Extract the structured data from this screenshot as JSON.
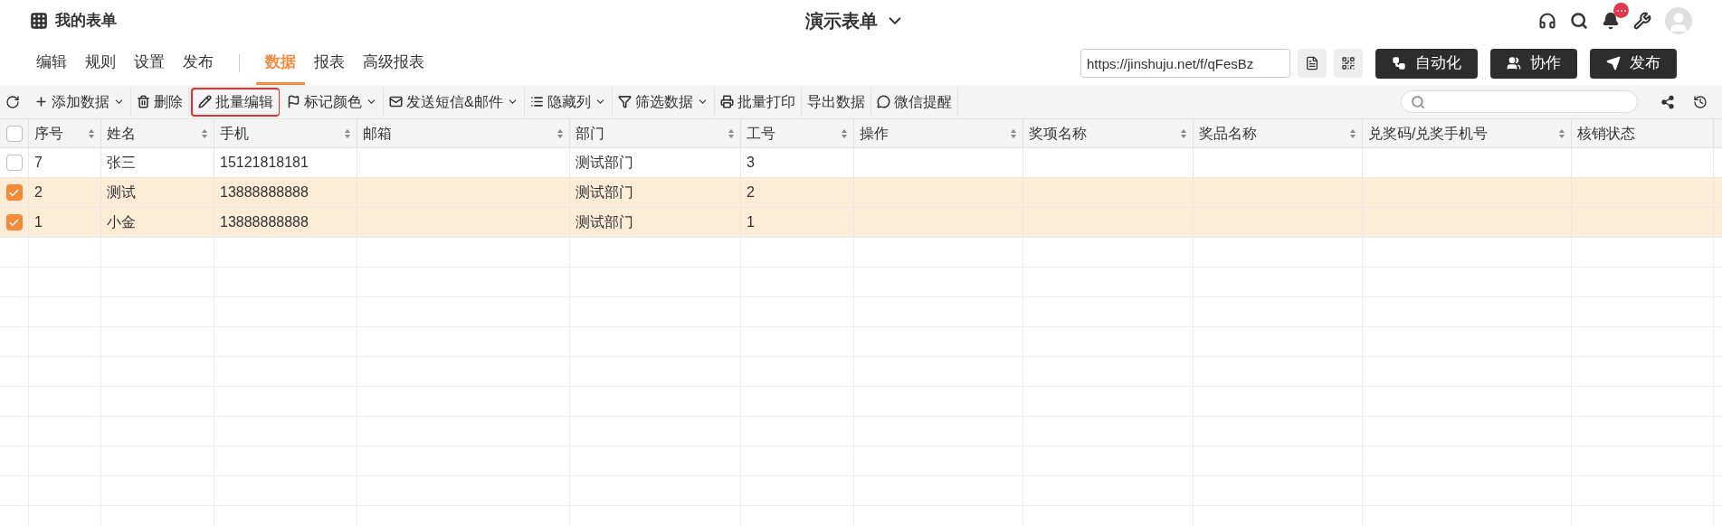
{
  "app": {
    "title": "我的表单",
    "form_title": "演示表单",
    "notification_badge": true
  },
  "nav_tabs": [
    {
      "label": "编辑",
      "selected": false
    },
    {
      "label": "规则",
      "selected": false
    },
    {
      "label": "设置",
      "selected": false
    },
    {
      "label": "发布",
      "selected": false
    },
    {
      "label": "数据",
      "selected": true
    },
    {
      "label": "报表",
      "selected": false
    },
    {
      "label": "高级报表",
      "selected": false
    }
  ],
  "share_url": "https://jinshuju.net/f/qFesBz",
  "action_buttons": [
    "自动化",
    "协作",
    "发布"
  ],
  "toolbar": [
    {
      "label": "添加数据",
      "dropdown": true,
      "highlighted": false
    },
    {
      "label": "删除",
      "dropdown": false,
      "highlighted": false
    },
    {
      "label": "批量编辑",
      "dropdown": false,
      "highlighted": true
    },
    {
      "label": "标记颜色",
      "dropdown": true,
      "highlighted": false
    },
    {
      "label": "发送短信&邮件",
      "dropdown": true,
      "highlighted": false
    },
    {
      "label": "隐藏列",
      "dropdown": true,
      "highlighted": false
    },
    {
      "label": "筛选数据",
      "dropdown": true,
      "highlighted": false
    },
    {
      "label": "批量打印",
      "dropdown": false,
      "highlighted": false
    },
    {
      "label": "导出数据",
      "dropdown": false,
      "highlighted": false
    },
    {
      "label": "微信提醒",
      "dropdown": false,
      "highlighted": false
    }
  ],
  "table": {
    "select_all": {
      "checked": false
    },
    "columns": [
      {
        "label": "序号",
        "sortable": true
      },
      {
        "label": "姓名",
        "sortable": true
      },
      {
        "label": "手机",
        "sortable": true
      },
      {
        "label": "邮箱",
        "sortable": true
      },
      {
        "label": "部门",
        "sortable": true
      },
      {
        "label": "工号",
        "sortable": true
      },
      {
        "label": "操作",
        "sortable": true
      },
      {
        "label": "奖项名称",
        "sortable": true
      },
      {
        "label": "奖品名称",
        "sortable": true
      },
      {
        "label": "兑奖码/兑奖手机号",
        "sortable": true
      },
      {
        "label": "核销状态",
        "sortable": false
      }
    ],
    "rows": [
      {
        "checked": false,
        "cells": [
          "7",
          "张三",
          "15121818181",
          "",
          "测试部门",
          "3",
          "",
          "",
          "",
          "",
          ""
        ]
      },
      {
        "checked": true,
        "cells": [
          "2",
          "测试",
          "13888888888",
          "",
          "测试部门",
          "2",
          "",
          "",
          "",
          "",
          ""
        ]
      },
      {
        "checked": true,
        "cells": [
          "1",
          "小金",
          "13888888888",
          "",
          "测试部门",
          "1",
          "",
          "",
          "",
          "",
          ""
        ]
      }
    ]
  }
}
